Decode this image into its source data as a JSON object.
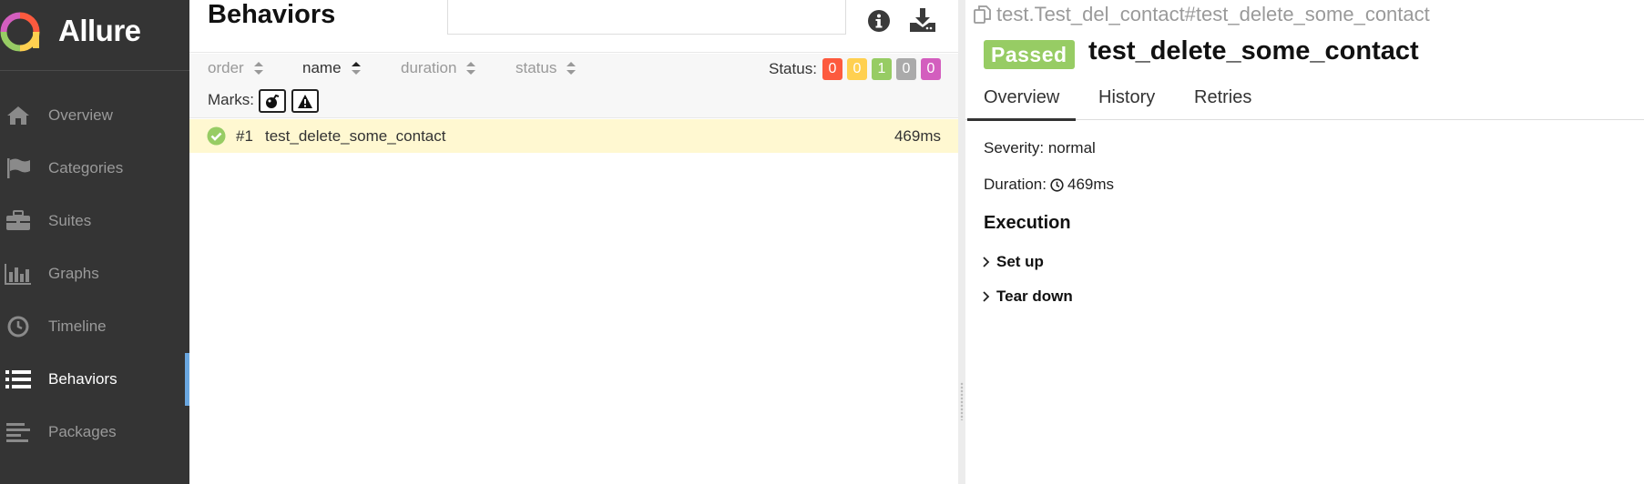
{
  "app": {
    "name": "Allure"
  },
  "sidebar": {
    "items": [
      {
        "label": "Overview",
        "icon": "home-icon",
        "active": false
      },
      {
        "label": "Categories",
        "icon": "flag-icon",
        "active": false
      },
      {
        "label": "Suites",
        "icon": "briefcase-icon",
        "active": false
      },
      {
        "label": "Graphs",
        "icon": "bar-chart-icon",
        "active": false
      },
      {
        "label": "Timeline",
        "icon": "clock-icon",
        "active": false
      },
      {
        "label": "Behaviors",
        "icon": "list-icon",
        "active": true
      },
      {
        "label": "Packages",
        "icon": "align-left-icon",
        "active": false
      }
    ]
  },
  "behaviors": {
    "title": "Behaviors",
    "sort": {
      "order": "order",
      "name": "name",
      "duration": "duration",
      "status": "status"
    },
    "status_label": "Status:",
    "status_counts": [
      {
        "value": "0",
        "color": "#fd5a3e",
        "name": "failed"
      },
      {
        "value": "0",
        "color": "#ffd050",
        "name": "broken"
      },
      {
        "value": "1",
        "color": "#97cc64",
        "name": "passed"
      },
      {
        "value": "0",
        "color": "#aaaaaa",
        "name": "skipped"
      },
      {
        "value": "0",
        "color": "#d35ebe",
        "name": "unknown"
      }
    ],
    "marks_label": "Marks:",
    "rows": [
      {
        "num": "#1",
        "name": "test_delete_some_contact",
        "duration": "469ms",
        "status": "passed"
      }
    ]
  },
  "test": {
    "path": "test.Test_del_contact#test_delete_some_contact",
    "status": "Passed",
    "title": "test_delete_some_contact",
    "tabs": [
      "Overview",
      "History",
      "Retries"
    ],
    "severity": "Severity: normal",
    "duration_label": "Duration:",
    "duration_value": "469ms",
    "execution_title": "Execution",
    "steps": [
      "Set up",
      "Tear down"
    ]
  },
  "colors": {
    "sidebar": "#343434",
    "accent": "#6aa7e0",
    "passed": "#97cc64",
    "selected_row": "#fff8d1"
  }
}
